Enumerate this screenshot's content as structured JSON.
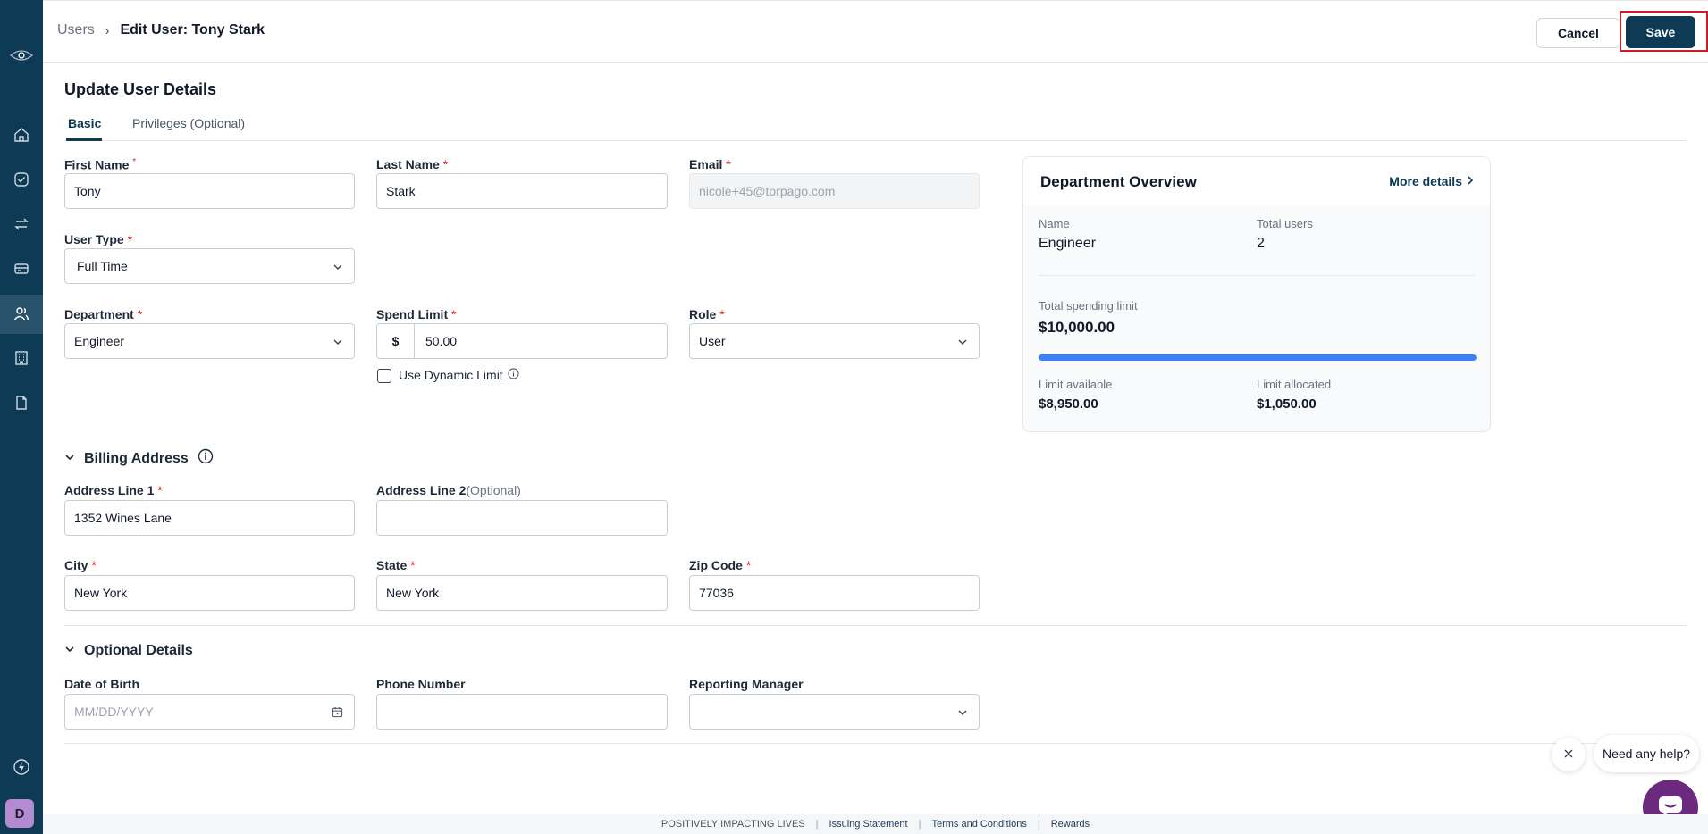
{
  "header": {
    "breadcrumb_parent": "Users",
    "breadcrumb_current": "Edit User: Tony Stark",
    "cancel_label": "Cancel",
    "save_label": "Save"
  },
  "page": {
    "title": "Update User Details",
    "tabs": [
      {
        "label": "Basic",
        "active": true
      },
      {
        "label": "Privileges (Optional)",
        "active": false
      }
    ]
  },
  "form": {
    "first_name": {
      "label": "First Name",
      "value": "Tony"
    },
    "last_name": {
      "label": "Last Name",
      "value": "Stark"
    },
    "email": {
      "label": "Email",
      "placeholder": "nicole+45@torpago.com"
    },
    "user_type": {
      "label": "User Type",
      "value": "Full Time"
    },
    "department": {
      "label": "Department",
      "value": "Engineer"
    },
    "spend_limit": {
      "label": "Spend Limit",
      "prefix": "$",
      "value": "50.00"
    },
    "role": {
      "label": "Role",
      "value": "User"
    },
    "dynamic_limit_label": "Use Dynamic Limit",
    "required_mark": "*"
  },
  "billing": {
    "heading": "Billing Address",
    "address1": {
      "label": "Address Line 1",
      "value": "1352 Wines Lane"
    },
    "address2": {
      "label": "Address Line 2",
      "optional": "(Optional)",
      "value": ""
    },
    "city": {
      "label": "City",
      "value": "New York"
    },
    "state": {
      "label": "State",
      "value": "New York"
    },
    "zip": {
      "label": "Zip Code",
      "value": "77036"
    }
  },
  "optional_details": {
    "heading": "Optional Details",
    "dob": {
      "label": "Date of Birth",
      "placeholder": "MM/DD/YYYY"
    },
    "phone": {
      "label": "Phone Number",
      "value": ""
    },
    "manager": {
      "label": "Reporting Manager",
      "value": ""
    }
  },
  "department_overview": {
    "title": "Department Overview",
    "more_details": "More details",
    "name_label": "Name",
    "name_value": "Engineer",
    "total_users_label": "Total users",
    "total_users_value": "2",
    "total_limit_label": "Total spending limit",
    "total_limit_value": "$10,000.00",
    "limit_available_label": "Limit available",
    "limit_available_value": "$8,950.00",
    "limit_allocated_label": "Limit allocated",
    "limit_allocated_value": "$1,050.00",
    "progress_fraction": 1.0
  },
  "help": {
    "bubble_text": "Need any help?"
  },
  "footer": {
    "tagline": "POSITIVELY IMPACTING LIVES",
    "links": [
      "Issuing Statement",
      "Terms and Conditions",
      "Rewards"
    ]
  },
  "sidebar": {
    "avatar_initial": "D",
    "items": [
      "home-icon",
      "check-circle-icon",
      "transfer-icon",
      "card-icon",
      "users-icon",
      "building-icon",
      "document-icon"
    ]
  },
  "colors": {
    "brand": "#0d3b56",
    "accent": "#3b82f6",
    "required": "#dc2626",
    "highlight": "#d11c24"
  }
}
